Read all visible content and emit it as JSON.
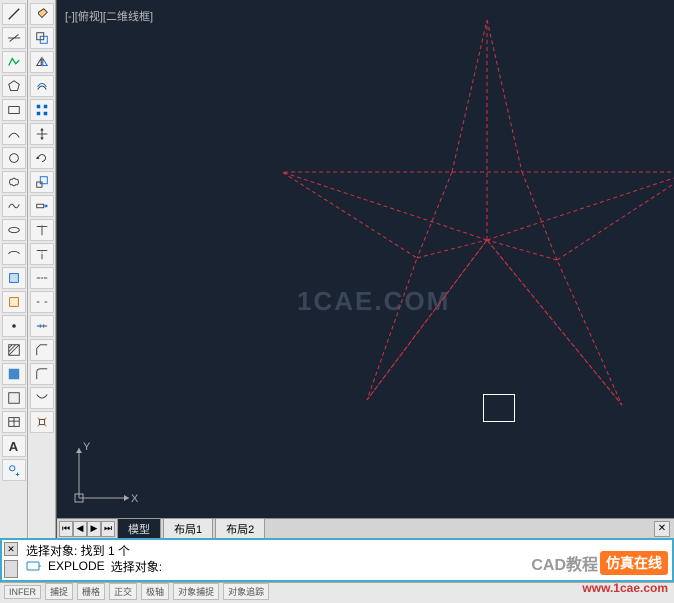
{
  "view": {
    "label": "[-][俯视][二维线框]"
  },
  "tabs": {
    "nav": [
      "⏮",
      "◀",
      "▶",
      "⏭"
    ],
    "model": "模型",
    "layout1": "布局1",
    "layout2": "布局2",
    "close": "✕"
  },
  "command": {
    "line1": "选择对象: 找到 1 个",
    "line2_prefix": "EXPLODE",
    "line2_text": "选择对象:",
    "close": "✕"
  },
  "watermark": {
    "center": "1CAE.COM",
    "cad_text": "CAD教程",
    "box_text": "仿真在线",
    "url": "www.1cae.com"
  },
  "status": {
    "items": [
      "INFER",
      "捕捉",
      "栅格",
      "正交",
      "极轴",
      "对象捕捉",
      "对象追踪"
    ]
  },
  "ucs": {
    "x": "X",
    "y": "Y"
  },
  "tools_left": [
    "line",
    "polyline",
    "circle",
    "arc",
    "rectangle",
    "polygon",
    "spline",
    "ellipse",
    "hatch",
    "point",
    "region",
    "divide",
    "revision",
    "wipeout",
    "text",
    "table",
    "dim",
    "mtext",
    "A-text",
    "helix"
  ],
  "tools_left2": [
    "move",
    "copy",
    "rotate",
    "trim",
    "mirror",
    "scale",
    "stretch",
    "fillet",
    "array",
    "erase",
    "explode",
    "offset",
    "extend",
    "break",
    "join",
    "chamfer",
    "align",
    "lengthen",
    "edit"
  ]
}
